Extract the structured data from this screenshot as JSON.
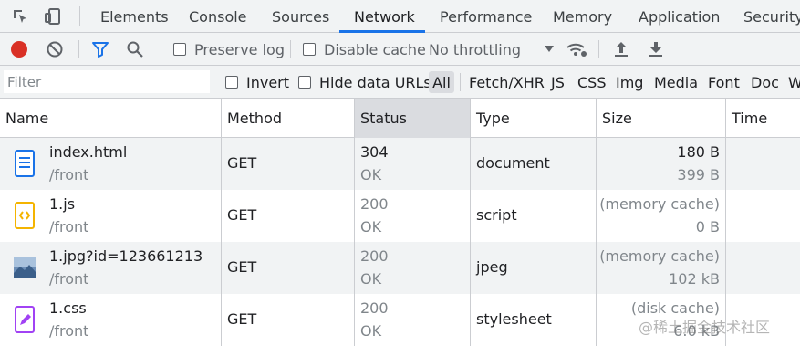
{
  "tabs": [
    "Elements",
    "Console",
    "Sources",
    "Network",
    "Performance",
    "Memory",
    "Application",
    "Security"
  ],
  "active_tab": "Network",
  "toolbar": {
    "preserve_log": "Preserve log",
    "disable_cache": "Disable cache",
    "throttling": "No throttling"
  },
  "filterbar": {
    "filter_placeholder": "Filter",
    "invert": "Invert",
    "hide_data_urls": "Hide data URLs",
    "types": [
      "All",
      "Fetch/XHR",
      "JS",
      "CSS",
      "Img",
      "Media",
      "Font",
      "Doc",
      "W"
    ]
  },
  "table": {
    "headers": [
      "Name",
      "Method",
      "Status",
      "Type",
      "Size",
      "Time"
    ],
    "sorted_column": "Status",
    "rows": [
      {
        "name": "index.html",
        "path": "/front",
        "method": "GET",
        "status": "304",
        "status_text": "OK",
        "type": "document",
        "size": "180 B",
        "size_sub": "399 B",
        "icon": "html-document-icon"
      },
      {
        "name": "1.js",
        "path": "/front",
        "method": "GET",
        "status": "200",
        "status_text": "OK",
        "type": "script",
        "size": "(memory cache)",
        "size_sub": "0 B",
        "icon": "script-file-icon"
      },
      {
        "name": "1.jpg?id=123661213",
        "path": "/front",
        "method": "GET",
        "status": "200",
        "status_text": "OK",
        "type": "jpeg",
        "size": "(memory cache)",
        "size_sub": "102 kB",
        "icon": "image-thumbnail-icon"
      },
      {
        "name": "1.css",
        "path": "/front",
        "method": "GET",
        "status": "200",
        "status_text": "OK",
        "type": "stylesheet",
        "size": "(disk cache)",
        "size_sub": "6.0 kB",
        "icon": "stylesheet-file-icon"
      }
    ]
  },
  "watermark": "@稀土掘金技术社区",
  "colors": {
    "record": "#d93025",
    "accent": "#1a73e8",
    "html_icon": "#1a73e8",
    "js_icon": "#f4b400",
    "css_icon": "#a142f4"
  }
}
